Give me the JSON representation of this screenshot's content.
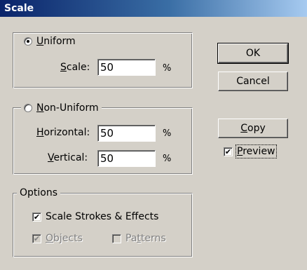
{
  "window": {
    "title": "Scale"
  },
  "uniform": {
    "radio_label_accel": "U",
    "radio_label_rest": "niform",
    "selected": true,
    "scale_label_accel": "S",
    "scale_label_rest": "cale:",
    "scale_value": "50",
    "scale_unit": "%"
  },
  "non_uniform": {
    "radio_label_accel": "N",
    "radio_label_rest": "on-Uniform",
    "selected": false,
    "horizontal_label_accel": "H",
    "horizontal_label_rest": "orizontal:",
    "horizontal_value": "50",
    "horizontal_unit": "%",
    "vertical_label_accel": "V",
    "vertical_label_rest": "ertical:",
    "vertical_value": "50",
    "vertical_unit": "%"
  },
  "options": {
    "title": "Options",
    "scale_strokes_label": "Scale Strokes & Effects",
    "scale_strokes_checked": true,
    "objects_accel": "O",
    "objects_rest": "bjects",
    "objects_checked": true,
    "patterns_pre": "Pa",
    "patterns_accel": "t",
    "patterns_rest": "terns",
    "patterns_checked": false
  },
  "buttons": {
    "ok_label": "OK",
    "cancel_label": "Cancel",
    "copy_accel": "C",
    "copy_rest": "opy"
  },
  "preview": {
    "accel": "P",
    "rest": "review",
    "checked": true
  },
  "glyphs": {
    "check": "✔"
  }
}
